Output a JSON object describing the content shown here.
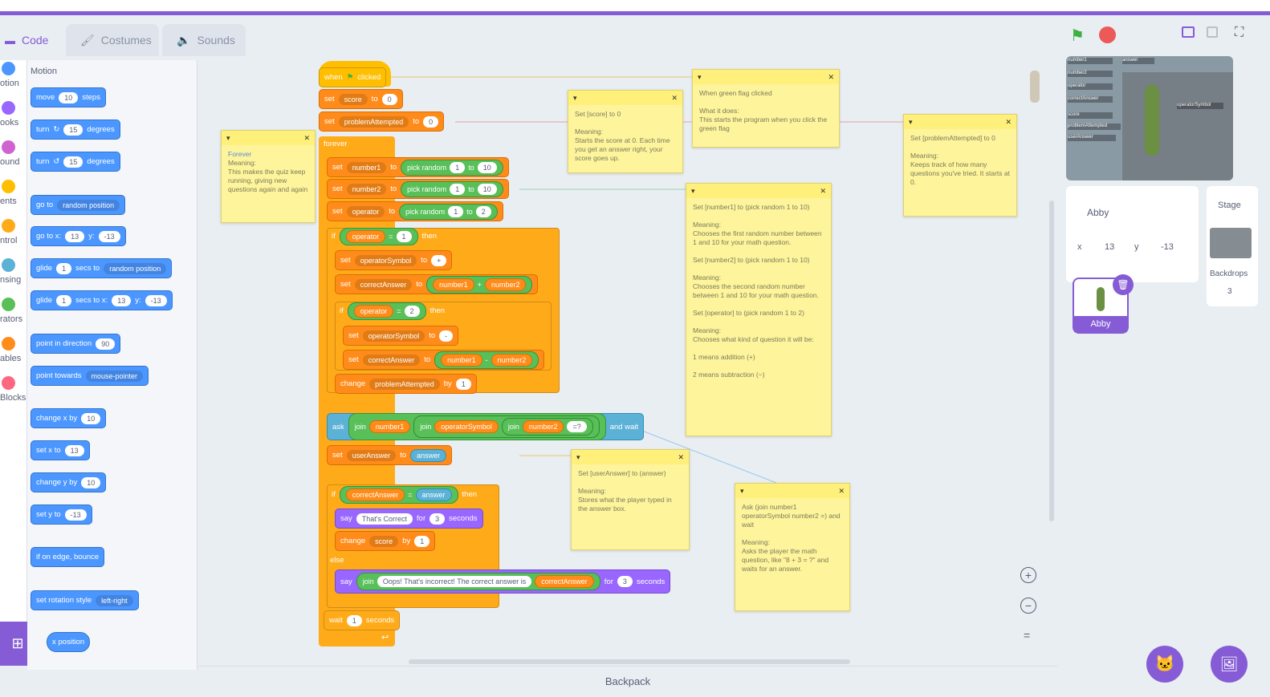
{
  "tabs": {
    "code": "Code",
    "costumes": "Costumes",
    "sounds": "Sounds"
  },
  "categories": [
    {
      "label": "otion",
      "color": "#4c97ff"
    },
    {
      "label": "ooks",
      "color": "#9966ff"
    },
    {
      "label": "ound",
      "color": "#cf63cf"
    },
    {
      "label": "ents",
      "color": "#ffbf00"
    },
    {
      "label": "ntrol",
      "color": "#ffab19"
    },
    {
      "label": "nsing",
      "color": "#5cb1d6"
    },
    {
      "label": "rators",
      "color": "#59c059"
    },
    {
      "label": "ables",
      "color": "#ff8c1a"
    },
    {
      "label": "Blocks",
      "color": "#ff6680"
    }
  ],
  "palette": {
    "heading": "Motion",
    "move": {
      "a": "move",
      "v": "10",
      "b": "steps"
    },
    "turn_cw": {
      "a": "turn",
      "v": "15",
      "b": "degrees"
    },
    "turn_ccw": {
      "a": "turn",
      "v": "15",
      "b": "degrees"
    },
    "goto": {
      "a": "go to",
      "dd": "random position"
    },
    "gotoxy": {
      "a": "go to x:",
      "x": "13",
      "yl": "y:",
      "y": "-13"
    },
    "glide": {
      "a": "glide",
      "v": "1",
      "b": "secs to",
      "dd": "random position"
    },
    "glidexy": {
      "a": "glide",
      "v": "1",
      "b": "secs to x:",
      "x": "13",
      "yl": "y:",
      "y": "-13"
    },
    "point_dir": {
      "a": "point in direction",
      "v": "90"
    },
    "point_towards": {
      "a": "point towards",
      "dd": "mouse-pointer"
    },
    "change_x": {
      "a": "change x by",
      "v": "10"
    },
    "set_x": {
      "a": "set x to",
      "v": "13"
    },
    "change_y": {
      "a": "change y by",
      "v": "10"
    },
    "set_y": {
      "a": "set y to",
      "v": "-13"
    },
    "bounce": "if on edge, bounce",
    "rotation": {
      "a": "set rotation style",
      "dd": "left-right"
    },
    "xpos": "x position"
  },
  "script": {
    "hat": {
      "a": "when",
      "b": "clicked"
    },
    "set_score": {
      "a": "set",
      "var": "score",
      "to": "to",
      "v": "0"
    },
    "set_pa": {
      "a": "set",
      "var": "problemAttempted",
      "to": "to",
      "v": "0"
    },
    "forever": "forever",
    "set_n1": {
      "a": "set",
      "var": "number1",
      "to": "to",
      "op": "pick random",
      "v1": "1",
      "t": "to",
      "v2": "10"
    },
    "set_n2": {
      "a": "set",
      "var": "number2",
      "to": "to",
      "op": "pick random",
      "v1": "1",
      "t": "to",
      "v2": "10"
    },
    "set_op": {
      "a": "set",
      "var": "operator",
      "to": "to",
      "op": "pick random",
      "v1": "1",
      "t": "to",
      "v2": "2"
    },
    "if1": {
      "a": "if",
      "var": "operator",
      "eq": "=",
      "v": "1",
      "then": "then"
    },
    "set_sym1": {
      "a": "set",
      "var": "operatorSymbol",
      "to": "to",
      "v": "+"
    },
    "set_ca1": {
      "a": "set",
      "var": "correctAnswer",
      "to": "to",
      "r1": "number1",
      "op": "+",
      "r2": "number2"
    },
    "if2": {
      "a": "if",
      "var": "operator",
      "eq": "=",
      "v": "2",
      "then": "then"
    },
    "set_sym2": {
      "a": "set",
      "var": "operatorSymbol",
      "to": "to",
      "v": "-"
    },
    "set_ca2": {
      "a": "set",
      "var": "correctAnswer",
      "to": "to",
      "r1": "number1",
      "op": "-",
      "r2": "number2"
    },
    "change_pa": {
      "a": "change",
      "var": "problemAttempted",
      "by": "by",
      "v": "1"
    },
    "ask": {
      "a": "ask",
      "j1": "join",
      "r1": "number1",
      "j2": "join",
      "r2": "operatorSymbol",
      "j3": "join",
      "r3": "number2",
      "v": "=?",
      "b": "and wait"
    },
    "set_ua": {
      "a": "set",
      "var": "userAnswer",
      "to": "to",
      "r": "answer"
    },
    "if3": {
      "a": "if",
      "r1": "correctAnswer",
      "eq": "=",
      "r2": "answer",
      "then": "then"
    },
    "say1": {
      "a": "say",
      "v": "That's Correct",
      "for": "for",
      "n": "3",
      "b": "seconds"
    },
    "change_score": {
      "a": "change",
      "var": "score",
      "by": "by",
      "v": "1"
    },
    "else": "else",
    "say2": {
      "a": "say",
      "j": "join",
      "v": "Oops!  That's incorrect! The correct answer is",
      "r": "correctAnswer",
      "for": "for",
      "n": "3",
      "b": "seconds"
    },
    "wait": {
      "a": "wait",
      "v": "1",
      "b": "seconds"
    }
  },
  "notes": [
    {
      "id": "forever",
      "title": "Forever",
      "body": "Meaning:\nThis makes the quiz keep running, giving new questions again and again"
    },
    {
      "id": "score",
      "title": "Set [score] to 0",
      "body": "Meaning:\nStarts the score at 0. Each time you get an answer right, your score goes up."
    },
    {
      "id": "flag",
      "title": "When green flag clicked",
      "body": "What it does:\nThis starts the program when you click the green flag"
    },
    {
      "id": "pa",
      "title": "Set [problemAttempted] to 0",
      "body": "Meaning:\nKeeps track of how many questions you've tried. It starts at 0."
    },
    {
      "id": "numbers",
      "title": "Set [number1] to (pick random 1 to 10)",
      "body": "Meaning:\nChooses the first random number between 1 and 10 for your math question.\n\nSet [number2] to (pick random 1 to 10)\n\nMeaning:\nChooses the second random number between 1 and 10 for your math question.\n\nSet [operator] to (pick random 1 to 2)\n\nMeaning:\nChooses what kind of question it will be:\n\n1 means addition (+)\n\n2 means subtraction (−)"
    },
    {
      "id": "ua",
      "title": "Set [userAnswer] to (answer)",
      "body": "Meaning:\nStores what the player typed in the answer box."
    },
    {
      "id": "ask",
      "title": "Ask (join number1 operatorSymbol number2 =) and wait",
      "body": "Meaning:\nAsks the player the math question, like \"8 + 3 = ?\" and waits for an answer."
    }
  ],
  "stage_monitors": [
    "number1",
    "answer",
    "number2",
    "operator",
    "correctAnswer",
    "score",
    "problemAttempted",
    "userAnswer",
    "operatorSymbol"
  ],
  "monitor_values": {
    "number1": "0",
    "number2": "0",
    "operator": "1",
    "correctAnswer": "10",
    "score": "0",
    "problemAttempted": "0",
    "userAnswer": "0"
  },
  "sprite_info": {
    "name": "Abby",
    "x_label": "x",
    "x": "13",
    "y_label": "y",
    "y": "-13"
  },
  "sprite_thumb": "Abby",
  "stage_panel": {
    "title": "Stage",
    "backdrops": "Backdrops",
    "count": "3"
  },
  "backpack": "Backpack",
  "colors": {
    "accent": "#855cd6",
    "motion": "#4c97ff",
    "variables": "#ff8c1a",
    "control": "#ffab19",
    "operators": "#59c059",
    "sensing": "#5cb1d6",
    "looks": "#9966ff",
    "note": "#fef49c"
  }
}
